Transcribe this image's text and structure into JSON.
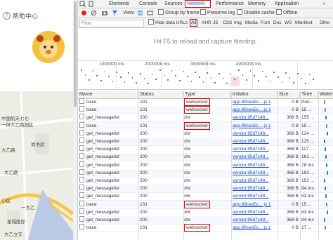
{
  "page": {
    "help_label": "帮助中心",
    "map_labels": [
      {
        "text": "中国航天七七",
        "pos": "a"
      },
      {
        "text": "一所大乙路园区",
        "pos": "b"
      },
      {
        "text": "大乙路",
        "pos": "c"
      },
      {
        "text": "尚书房",
        "pos": "d"
      },
      {
        "text": "大乙路",
        "pos": "e"
      },
      {
        "text": "小区",
        "pos": "f"
      },
      {
        "text": "一大乙",
        "pos": "g"
      },
      {
        "text": "星城国际",
        "pos": "h"
      },
      {
        "text": "大乙立交",
        "pos": "i"
      }
    ]
  },
  "devtools": {
    "panel_tabs": [
      "Elements",
      "Console",
      "Sources",
      "Network",
      "Performance",
      "Memory",
      "Application"
    ],
    "active_tab": "Network",
    "toolbar": {
      "view_label": "View:",
      "group_by_frame": "Group by frame",
      "preserve_log": "Preserve log",
      "disable_cache": "Disable cache",
      "offline": "Offline"
    },
    "filter": {
      "placeholder": "Filter",
      "hide_data_urls": "Hide data URLs",
      "types": [
        "All",
        "XHR",
        "JS",
        "CSS",
        "Img",
        "Media",
        "Font",
        "Doc",
        "WS",
        "Manifest",
        "Othe"
      ]
    },
    "hint": "Hit F5 to reload and capture filmstrip.",
    "timeline_labels": [
      "1000000 ms",
      "2000000 ms",
      "3000000 ms",
      "4000000 ms"
    ],
    "columns": [
      "Name",
      "Status",
      "Type",
      "Initiator",
      "Size",
      "Time",
      "Waterf"
    ],
    "rows": [
      {
        "name": "trace",
        "status": "101",
        "type": "websocket",
        "initiator": "app.89cea5c....js:1",
        "size": "0 B",
        "time": "Pen..."
      },
      {
        "name": "trace",
        "status": "101",
        "type": "websocket",
        "initiator": "app.89cea5c....js:1",
        "size": "0 B",
        "time": "15 ..."
      },
      {
        "name": "get_messagelist",
        "status": "200",
        "type": "xhr",
        "initiator": "vendor.95d7c48...",
        "size": "368 B",
        "time": "155 ..."
      },
      {
        "name": "trace",
        "status": "101",
        "type": "websocket",
        "initiator": "app.89cea5c....js:1",
        "size": "0 B",
        "time": "15 ..."
      },
      {
        "name": "get_messagelist",
        "status": "200",
        "type": "xhr",
        "initiator": "vendor.95d7c48...",
        "size": "368 B",
        "time": "124 ..."
      },
      {
        "name": "get_messagelist",
        "status": "200",
        "type": "xhr",
        "initiator": "vendor.95d7c48...",
        "size": "368 B",
        "time": "125 ..."
      },
      {
        "name": "get_messagelist",
        "status": "200",
        "type": "xhr",
        "initiator": "vendor.95d7c48...",
        "size": "368 B",
        "time": "117 ..."
      },
      {
        "name": "get_messagelist",
        "status": "200",
        "type": "xhr",
        "initiator": "vendor.95d7c48...",
        "size": "368 B",
        "time": "161 ..."
      },
      {
        "name": "get_messagelist",
        "status": "200",
        "type": "xhr",
        "initiator": "vendor.95d7c48...",
        "size": "368 B",
        "time": "78 ms"
      },
      {
        "name": "get_messagelist",
        "status": "200",
        "type": "xhr",
        "initiator": "vendor.95d7c48...",
        "size": "368 B",
        "time": "193 ..."
      },
      {
        "name": "get_messagelist",
        "status": "200",
        "type": "xhr",
        "initiator": "vendor.95d7c48...",
        "size": "368 B",
        "time": "152 ..."
      },
      {
        "name": "get_messagelist",
        "status": "200",
        "type": "xhr",
        "initiator": "vendor.95d7c48...",
        "size": "368 B",
        "time": "94 ms"
      },
      {
        "name": "get_messagelist",
        "status": "200",
        "type": "xhr",
        "initiator": "vendor.95d7c48...",
        "size": "368 B",
        "time": "93 ms"
      },
      {
        "name": "trace",
        "status": "101",
        "type": "websocket",
        "initiator": "app.89cea5c....js:1",
        "size": "0 B",
        "time": "15 ..."
      },
      {
        "name": "get_messagelist",
        "status": "200",
        "type": "xhr",
        "initiator": "vendor.95d7c48...",
        "size": "368 B",
        "time": "83 ms"
      },
      {
        "name": "get_messagelist",
        "status": "200",
        "type": "xhr",
        "initiator": "vendor.95d7c48...",
        "size": "368 B",
        "time": "94 ms"
      },
      {
        "name": "trace",
        "status": "101",
        "type": "websocket",
        "initiator": "app.89cea5c....js:1",
        "size": "0 B",
        "time": "17 ..."
      }
    ],
    "highlight_color": "#e00000"
  }
}
